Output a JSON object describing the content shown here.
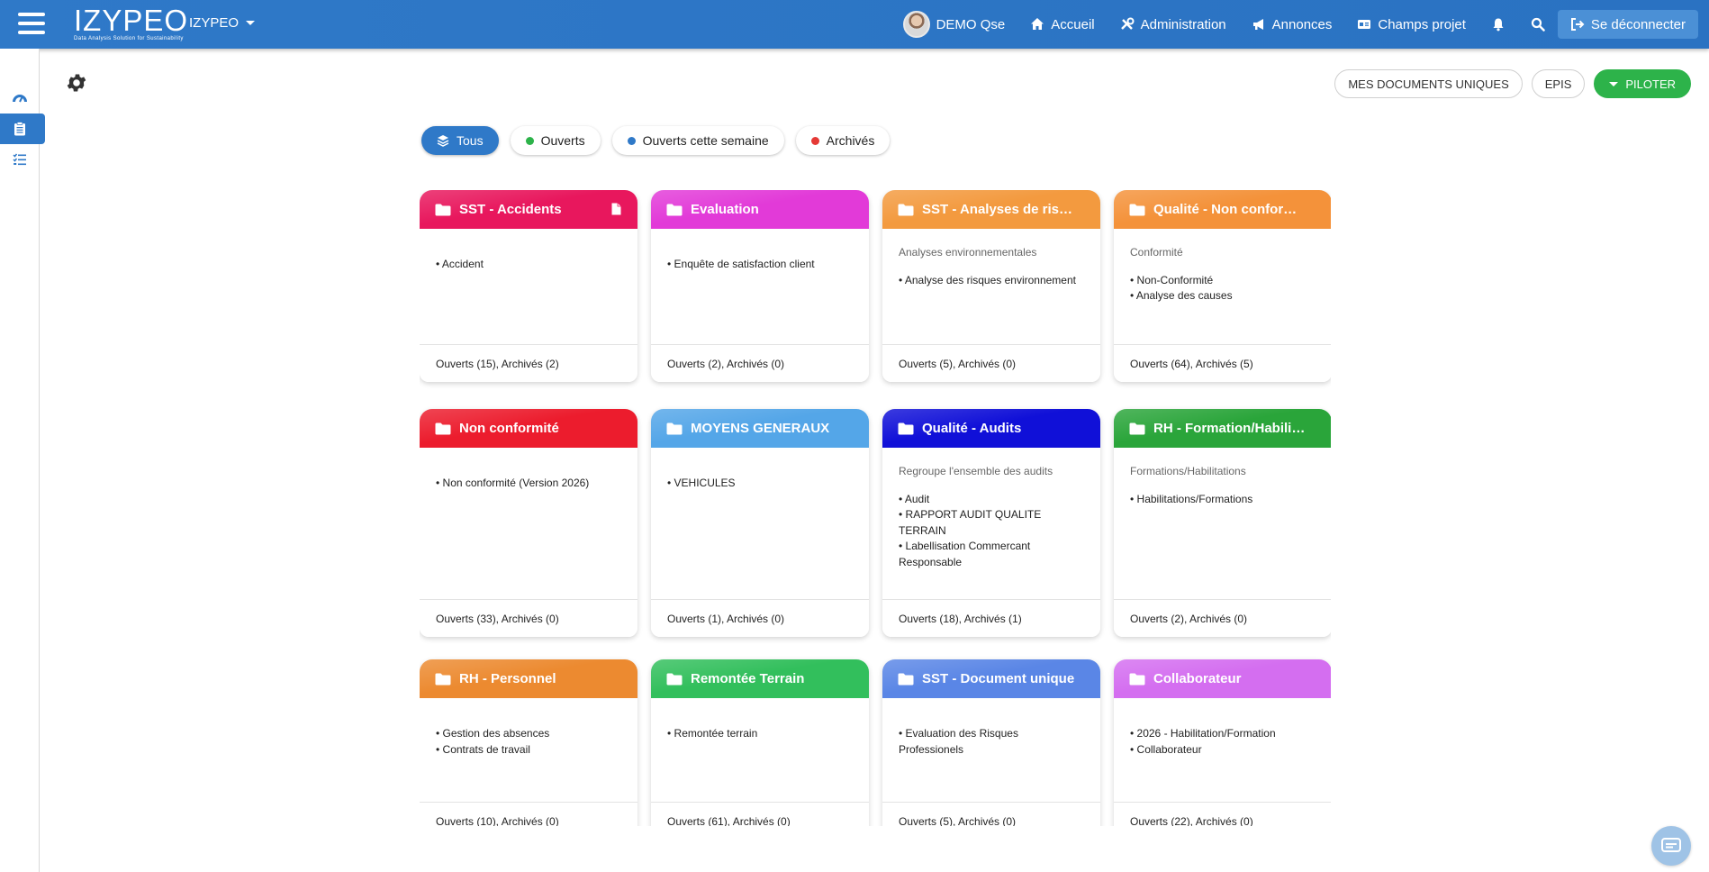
{
  "header": {
    "logo_text": "IZYPEO",
    "logo_tagline": "Data Analysis Solution for Sustainability",
    "org_name": "IZYPEO",
    "user_name": "DEMO Qse",
    "nav": [
      {
        "label": "Accueil",
        "icon": "home-icon"
      },
      {
        "label": "Administration",
        "icon": "tools-icon"
      },
      {
        "label": "Annonces",
        "icon": "megaphone-icon"
      },
      {
        "label": "Champs projet",
        "icon": "id-card-icon"
      }
    ],
    "logout_label": "Se déconnecter"
  },
  "toolbar": {
    "buttons": [
      "MES DOCUMENTS UNIQUES",
      "EPIS"
    ],
    "pilot_label": "PILOTER",
    "pilot_color": "#2db34a"
  },
  "filters": [
    {
      "label": "Tous",
      "active": true,
      "color": "#2f79c8"
    },
    {
      "label": "Ouverts",
      "color": "#2db34a"
    },
    {
      "label": "Ouverts cette semaine",
      "color": "#2f79c8"
    },
    {
      "label": "Archivés",
      "color": "#e53935"
    }
  ],
  "projects": [
    {
      "title": "SST - Accidents",
      "color": "#e8175d",
      "items": [
        "• Accident"
      ],
      "footer": "Ouverts (15), Archivés (2)"
    },
    {
      "title": "Evaluation",
      "color": "#e23ad8",
      "items": [
        "• Enquête de satisfaction client"
      ],
      "footer": "Ouverts (2), Archivés (0)"
    },
    {
      "title": "SST - Analyses de risques",
      "color": "#f39a3f",
      "subtitle": "Analyses environnementales",
      "items": [
        "• Analyse des risques environnement"
      ],
      "footer": "Ouverts (5), Archivés (0)"
    },
    {
      "title": "Qualité - Non conformité",
      "color": "#f4923a",
      "subtitle": "Conformité",
      "items": [
        "• Non-Conformité",
        "• Analyse des causes"
      ],
      "footer": "Ouverts (64), Archivés (5)"
    },
    {
      "title": "Non conformité",
      "color": "#ec1c2d",
      "items": [
        "• Non conformité (Version 2026)"
      ],
      "footer": "Ouverts (33), Archivés (0)"
    },
    {
      "title": "MOYENS GENERAUX",
      "color": "#54a6e8",
      "items": [
        "• VEHICULES"
      ],
      "footer": "Ouverts (1), Archivés (0)"
    },
    {
      "title": "Qualité - Audits",
      "color": "#1010d8",
      "subtitle": "Regroupe l'ensemble des audits",
      "items": [
        "• Audit",
        "• RAPPORT AUDIT QUALITE TERRAIN",
        "• Labellisation Commercant Responsable"
      ],
      "footer": "Ouverts (18), Archivés (1)"
    },
    {
      "title": "RH - Formation/Habilitations",
      "color": "#2aa53a",
      "subtitle": "Formations/Habilitations",
      "items": [
        "• Habilitations/Formations"
      ],
      "footer": "Ouverts (2), Archivés (0)"
    },
    {
      "title": "RH - Personnel",
      "color": "#ec8a30",
      "items": [
        "• Gestion des absences",
        "• Contrats de travail"
      ],
      "footer": "Ouverts (10), Archivés (0)"
    },
    {
      "title": "Remontée Terrain",
      "color": "#32bf5c",
      "items": [
        "• Remontée terrain"
      ],
      "footer": "Ouverts (61), Archivés (0)"
    },
    {
      "title": "SST - Document unique",
      "color": "#5a86e6",
      "items": [
        "• Evaluation des Risques Professionels"
      ],
      "footer": "Ouverts (5), Archivés (0)"
    },
    {
      "title": "Collaborateur",
      "color": "#d46ef0",
      "items": [
        "• 2026 - Habilitation/Formation",
        "• Collaborateur"
      ],
      "footer": "Ouverts (22), Archivés (0)"
    }
  ]
}
